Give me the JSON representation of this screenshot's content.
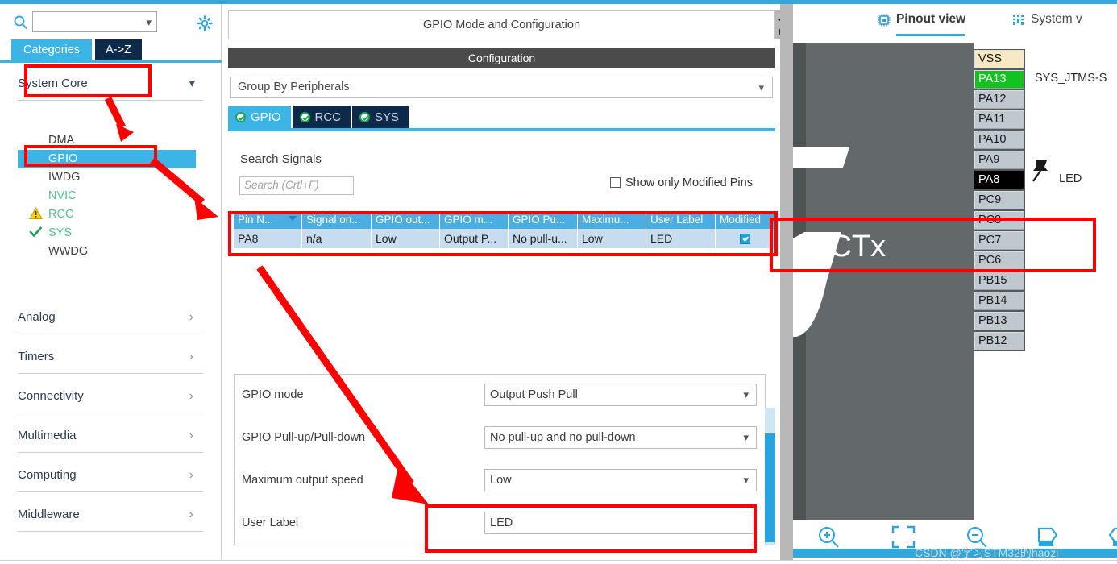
{
  "left_panel": {
    "search": {
      "value": "",
      "placeholder": ""
    },
    "icons": {
      "search": "search-icon",
      "settings": "gear-icon"
    },
    "tabs": [
      {
        "label": "Categories",
        "active": true
      },
      {
        "label": "A->Z",
        "active": false
      }
    ],
    "categories": [
      {
        "label": "System Core",
        "expanded": true,
        "highlighted": true
      },
      {
        "label": "Analog",
        "expanded": false
      },
      {
        "label": "Timers",
        "expanded": false
      },
      {
        "label": "Connectivity",
        "expanded": false
      },
      {
        "label": "Multimedia",
        "expanded": false
      },
      {
        "label": "Computing",
        "expanded": false
      },
      {
        "label": "Middleware",
        "expanded": false
      }
    ],
    "peripherals": [
      {
        "label": "DMA",
        "status": "none",
        "selected": false
      },
      {
        "label": "GPIO",
        "status": "none",
        "selected": true
      },
      {
        "label": "IWDG",
        "status": "none",
        "selected": false
      },
      {
        "label": "NVIC",
        "status": "configured",
        "selected": false
      },
      {
        "label": "RCC",
        "status": "warning",
        "selected": false
      },
      {
        "label": "SYS",
        "status": "ok",
        "selected": false
      },
      {
        "label": "WWDG",
        "status": "none",
        "selected": false
      }
    ]
  },
  "center_panel": {
    "title": "GPIO Mode and Configuration",
    "configuration_band": "Configuration",
    "group_by": {
      "value": "Group By Peripherals"
    },
    "peripheral_tabs": [
      {
        "label": "GPIO",
        "active": true,
        "status": "ok"
      },
      {
        "label": "RCC",
        "active": false,
        "status": "ok"
      },
      {
        "label": "SYS",
        "active": false,
        "status": "ok"
      }
    ],
    "search_signals_label": "Search Signals",
    "search_signals": {
      "value": "",
      "placeholder": "Search (Crtl+F)"
    },
    "show_only_modified": {
      "label": "Show only Modified Pins",
      "checked": false
    },
    "table": {
      "columns": [
        "Pin N...",
        "Signal on...",
        "GPIO out...",
        "GPIO m...",
        "GPIO Pu...",
        "Maximu...",
        "User Label",
        "Modified"
      ],
      "rows": [
        {
          "pin_name": "PA8",
          "signal_on_pin": "n/a",
          "gpio_output_level": "Low",
          "gpio_mode": "Output P...",
          "gpio_pull": "No pull-u...",
          "maximum_speed": "Low",
          "user_label": "LED",
          "modified": true
        }
      ]
    },
    "form": [
      {
        "label": "GPIO mode",
        "value": "Output Push Pull",
        "type": "select"
      },
      {
        "label": "GPIO Pull-up/Pull-down",
        "value": "No pull-up and no pull-down",
        "type": "select"
      },
      {
        "label": "Maximum output speed",
        "value": "Low",
        "type": "select"
      },
      {
        "label": "User Label",
        "value": "LED",
        "type": "text"
      }
    ]
  },
  "right_panel": {
    "view_tabs": [
      {
        "label": "Pinout view",
        "active": true,
        "icon": "chip-icon"
      },
      {
        "label": "System v",
        "active": false,
        "icon": "system-view-icon"
      }
    ],
    "chip_label": "RCTx",
    "pins": [
      {
        "name": "VSS",
        "state": "power",
        "signal": ""
      },
      {
        "name": "PA13",
        "state": "assigned",
        "signal": "SYS_JTMS-S"
      },
      {
        "name": "PA12",
        "state": "free",
        "signal": ""
      },
      {
        "name": "PA11",
        "state": "free",
        "signal": ""
      },
      {
        "name": "PA10",
        "state": "free",
        "signal": ""
      },
      {
        "name": "PA9",
        "state": "free",
        "signal": ""
      },
      {
        "name": "PA8",
        "state": "selected",
        "signal": "LED"
      },
      {
        "name": "PC9",
        "state": "free",
        "signal": ""
      },
      {
        "name": "PC8",
        "state": "free",
        "signal": ""
      },
      {
        "name": "PC7",
        "state": "free",
        "signal": ""
      },
      {
        "name": "PC6",
        "state": "free",
        "signal": ""
      },
      {
        "name": "PB15",
        "state": "free",
        "signal": ""
      },
      {
        "name": "PB14",
        "state": "free",
        "signal": ""
      },
      {
        "name": "PB13",
        "state": "free",
        "signal": ""
      },
      {
        "name": "PB12",
        "state": "free",
        "signal": ""
      }
    ],
    "toolbar_icons": [
      "zoom-in-icon",
      "fit-to-screen-icon",
      "zoom-out-icon",
      "rotate-right-icon",
      "rotate-left-icon"
    ]
  },
  "watermark": "CSDN @学习STM32的haozi",
  "colors": {
    "accent_blue": "#2fa8dd",
    "tab_blue": "#3cb4e5",
    "dark_navy": "#0e2a4a",
    "annotation_red": "#ff0000",
    "pin_free": "#bfc8ce",
    "pin_power": "#f6e9c3",
    "pin_assigned": "#14c21e",
    "pin_selected": "#000000",
    "chip_body": "#63696a"
  }
}
